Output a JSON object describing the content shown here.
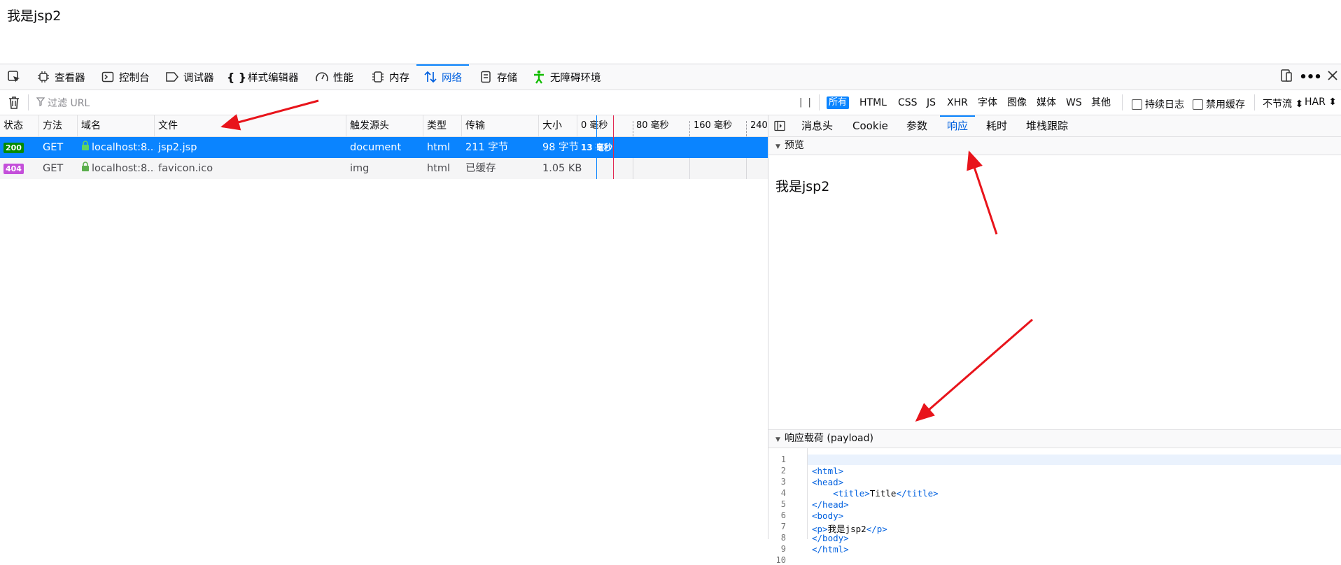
{
  "page": {
    "text": "我是jsp2"
  },
  "toolbar": {
    "items": [
      {
        "label": "查看器",
        "icon": "inspector-icon"
      },
      {
        "label": "控制台",
        "icon": "console-icon"
      },
      {
        "label": "调试器",
        "icon": "debugger-icon"
      },
      {
        "label": "样式编辑器",
        "icon": "style-editor-icon"
      },
      {
        "label": "性能",
        "icon": "performance-icon"
      },
      {
        "label": "内存",
        "icon": "memory-icon"
      },
      {
        "label": "网络",
        "icon": "network-icon",
        "active": true
      },
      {
        "label": "存储",
        "icon": "storage-icon"
      },
      {
        "label": "无障碍环境",
        "icon": "accessibility-icon"
      }
    ],
    "accent": "#0a84ff"
  },
  "filterbar": {
    "placeholder": "过滤 URL",
    "pause": "| |",
    "types": [
      "所有",
      "HTML",
      "CSS",
      "JS",
      "XHR",
      "字体",
      "图像",
      "媒体",
      "WS",
      "其他"
    ],
    "active_type": "所有",
    "persist_logs": "持续日志",
    "disable_cache": "禁用缓存",
    "throttle": "不节流 ⬍",
    "har": "HAR ⬍"
  },
  "table": {
    "headers": {
      "status": "状态",
      "method": "方法",
      "domain": "域名",
      "file": "文件",
      "cause": "触发源头",
      "type": "类型",
      "transferred": "传输",
      "size": "大小"
    },
    "ticks": [
      "0 毫秒",
      "80 毫秒",
      "160 毫秒",
      "240"
    ],
    "rows": [
      {
        "status": "200",
        "status_color": "#058b00",
        "method": "GET",
        "domain": "localhost:8...",
        "file": "jsp2.jsp",
        "cause": "document",
        "type": "html",
        "transferred": "211 字节",
        "size": "98 字节",
        "timing": "13 毫秒"
      },
      {
        "status": "404",
        "status_color": "#c44fda",
        "method": "GET",
        "domain": "localhost:8...",
        "file": "favicon.ico",
        "cause": "img",
        "type": "html",
        "transferred": "已缓存",
        "size": "1.05 KB",
        "timing": ""
      }
    ]
  },
  "side": {
    "tabs": [
      "消息头",
      "Cookie",
      "参数",
      "响应",
      "耗时",
      "堆栈跟踪"
    ],
    "active_tab": "响应",
    "preview_title": "预览",
    "preview_text": "我是jsp2",
    "payload_title": "响应载荷 (payload)",
    "code_line_numbers": [
      "1",
      "2",
      "3",
      "4",
      "5",
      "6",
      "7",
      "8",
      "9",
      "10"
    ],
    "code": {
      "l2": "<html>",
      "l3": "<head>",
      "l4_open": "<title>",
      "l4_text": "Title",
      "l4_close": "</title>",
      "l5": "</head>",
      "l6": "<body>",
      "l7_open": "<p>",
      "l7_text": "我是jsp2",
      "l7_close": "</p>",
      "l8": "</body>",
      "l9": "</html>"
    }
  }
}
